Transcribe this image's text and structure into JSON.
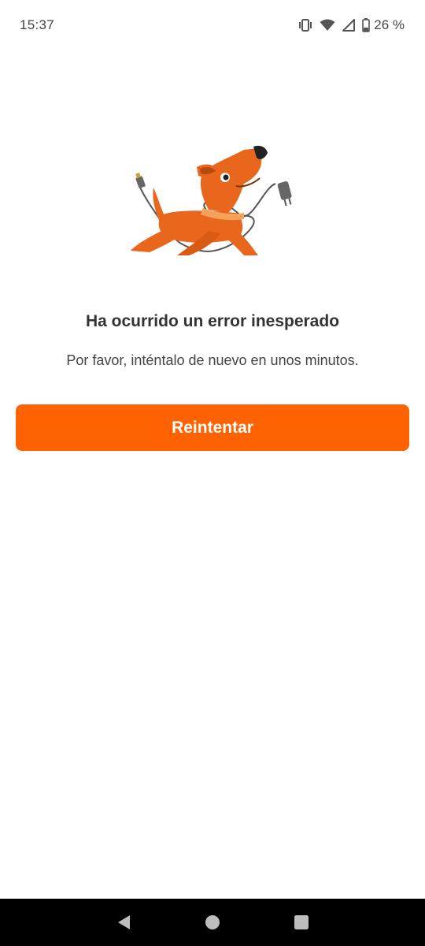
{
  "status_bar": {
    "time": "15:37",
    "battery_percent": "26 %",
    "icons": [
      "vibrate-icon",
      "wifi-icon",
      "signal-icon",
      "battery-icon"
    ]
  },
  "illustration": {
    "icon": "dog-with-cable-illustration",
    "colors": {
      "body": "#E8671C",
      "collar": "#F4A15A",
      "cable": "#555555"
    }
  },
  "error": {
    "title": "Ha ocurrido un error inesperado",
    "message": "Por favor, inténtalo de nuevo en unos minutos."
  },
  "actions": {
    "retry_label": "Reintentar",
    "retry_color": "#FF6200"
  },
  "nav_bar": {
    "buttons": [
      "back-icon",
      "home-icon",
      "recents-icon"
    ]
  }
}
